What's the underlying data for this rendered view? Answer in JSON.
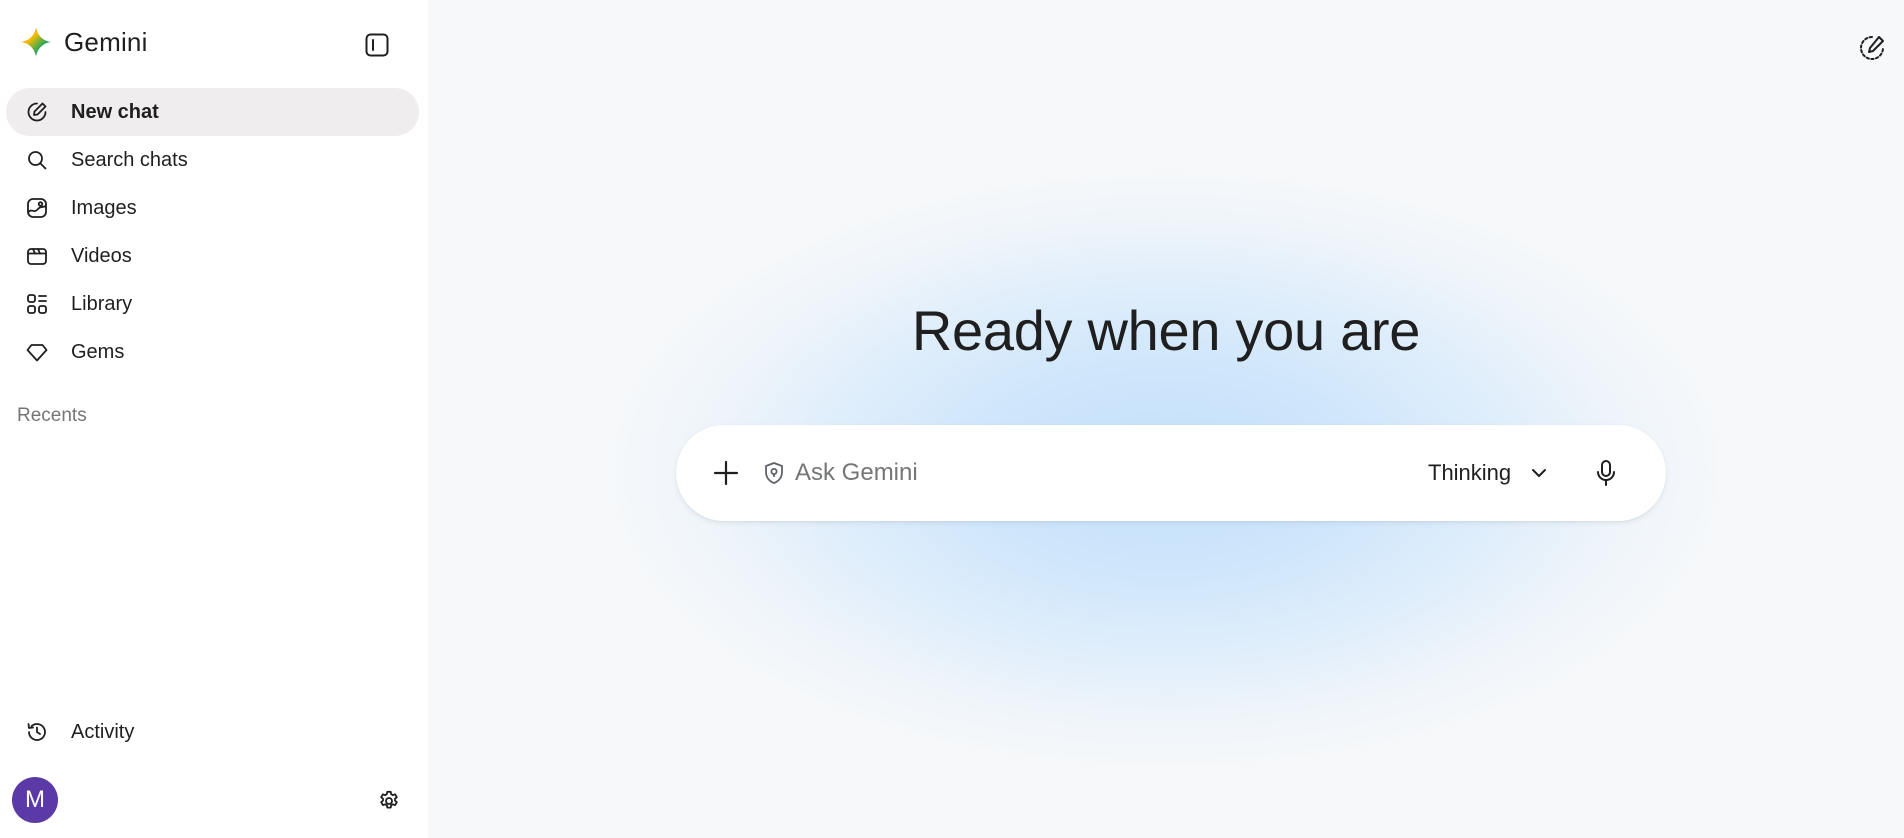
{
  "brand": {
    "name": "Gemini",
    "logo_icon": "gemini-star-icon"
  },
  "sidebar": {
    "collapse_icon": "sidebar-toggle-icon",
    "nav": [
      {
        "label": "New chat",
        "icon": "edit-pencil-icon",
        "active": true
      },
      {
        "label": "Search chats",
        "icon": "search-icon"
      },
      {
        "label": "Images",
        "icon": "image-icon"
      },
      {
        "label": "Videos",
        "icon": "video-icon"
      },
      {
        "label": "Library",
        "icon": "library-grid-icon"
      },
      {
        "label": "Gems",
        "icon": "gem-icon"
      }
    ],
    "recents_title": "Recents",
    "activity_label": "Activity",
    "activity_icon": "history-icon",
    "avatar_initial": "M",
    "settings_icon": "gear-icon"
  },
  "main": {
    "headline": "Ready when you are",
    "prompt": {
      "placeholder": "Ask Gemini",
      "value": "",
      "mode_label": "Thinking",
      "plus_icon": "plus-icon",
      "shield_icon": "shield-icon",
      "mic_icon": "mic-icon",
      "chevron_icon": "chevron-down-icon"
    },
    "top_right_icon": "edit-pencil-icon"
  },
  "colors": {
    "active_nav_bg": "#efeded",
    "avatar_bg": "#5b3aa7",
    "glow": "#c3e0fb",
    "text": "#1f1f1f",
    "muted": "#747775"
  }
}
